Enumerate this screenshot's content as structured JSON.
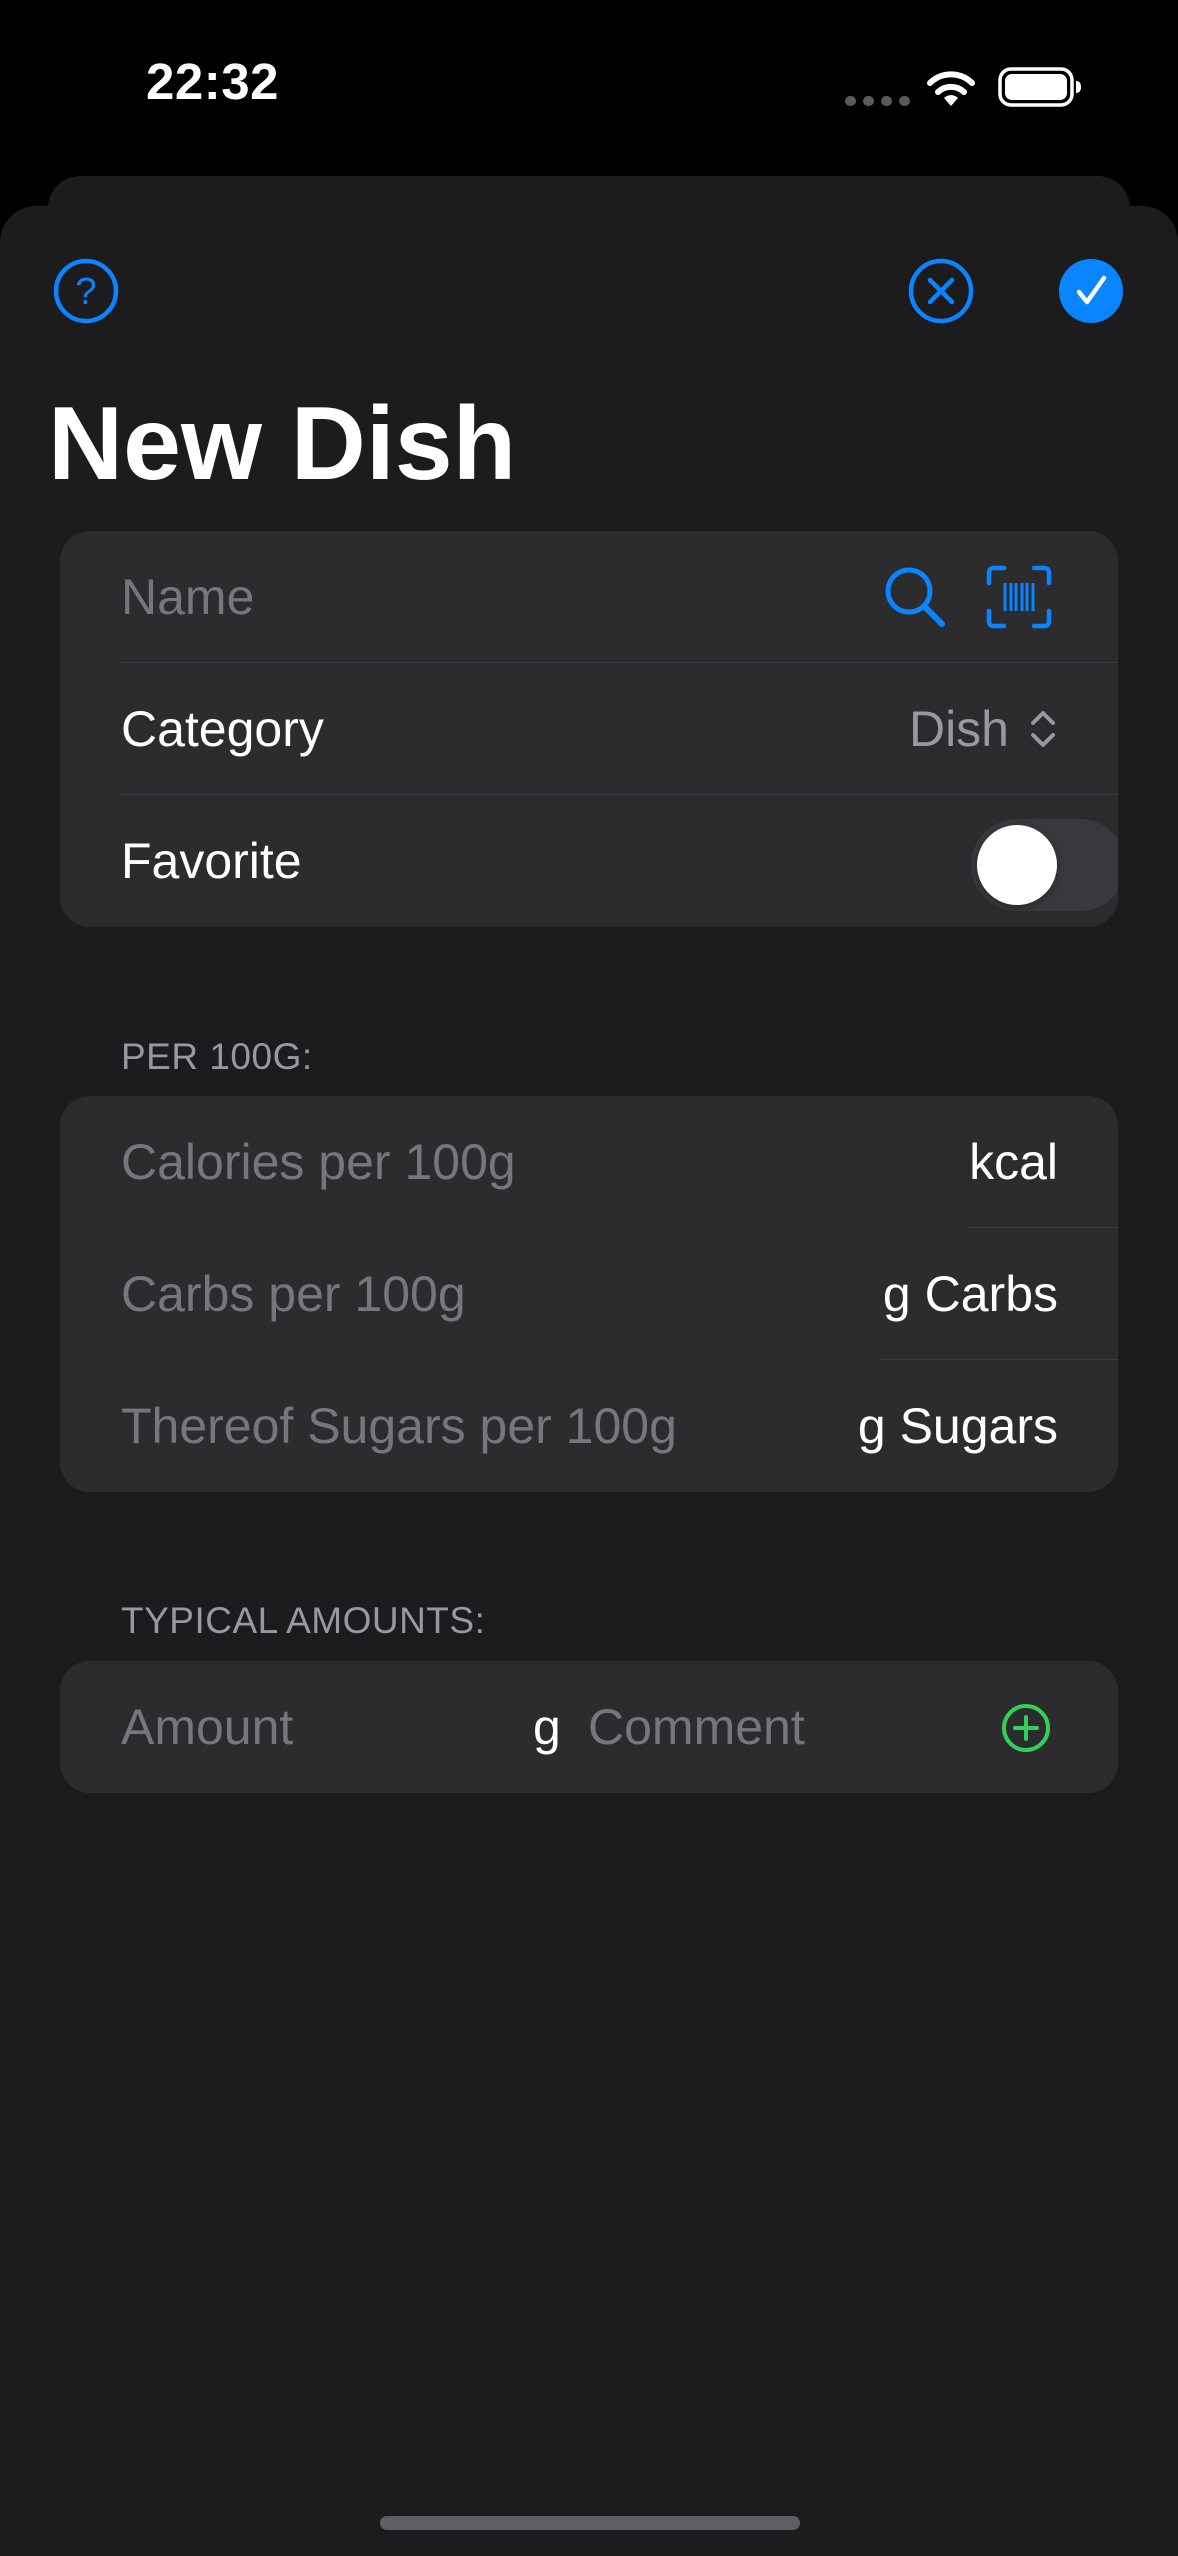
{
  "status_bar": {
    "time": "22:32"
  },
  "header": {
    "title": "New Dish",
    "help_icon": "question-circle-icon",
    "close_icon": "xmark-circle-icon",
    "done_icon": "checkmark-circle-fill-icon",
    "accent_color": "#0a84ff"
  },
  "general": {
    "name_placeholder": "Name",
    "category_label": "Category",
    "category_value": "Dish",
    "favorite_label": "Favorite",
    "favorite_on": false
  },
  "per100": {
    "header": "PER 100G:",
    "fields": [
      {
        "placeholder": "Calories per 100g",
        "unit": "kcal"
      },
      {
        "placeholder": "Carbs per 100g",
        "unit": "g Carbs"
      },
      {
        "placeholder": "Thereof Sugars per 100g",
        "unit": "g Sugars"
      }
    ]
  },
  "typical": {
    "header": "TYPICAL AMOUNTS:",
    "amount_placeholder": "Amount",
    "amount_unit": "g",
    "comment_placeholder": "Comment",
    "add_icon": "plus-circle-icon",
    "add_color": "#30d158"
  }
}
